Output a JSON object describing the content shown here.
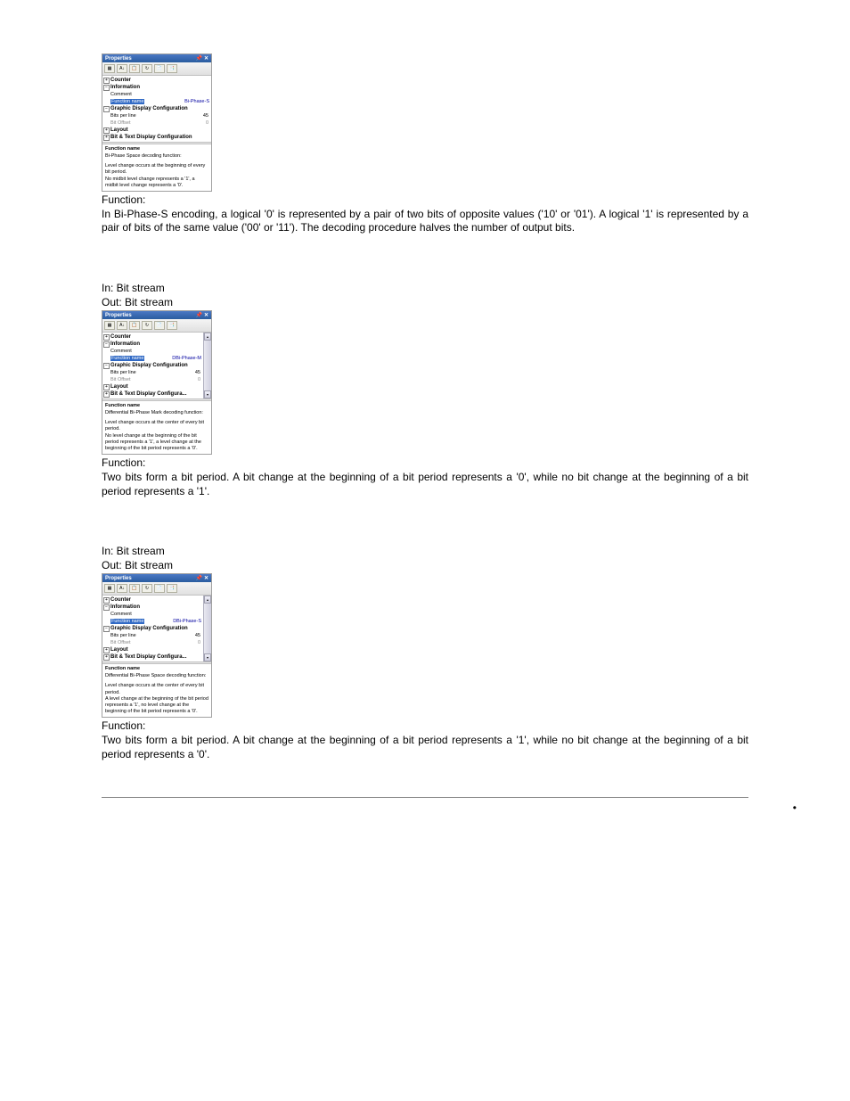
{
  "panel1": {
    "title": "Properties",
    "tree": {
      "counter": "Counter",
      "information": "Information",
      "comment": "Comment",
      "functionNameLabel": "Function name",
      "functionNameValue": "Bi-Phase-S",
      "gdc": "Graphic Display Configuration",
      "bitsPerLineLabel": "Bits per line",
      "bitsPerLineValue": "45",
      "bitOffsetLabel": "Bit Offset",
      "bitOffsetValue": "0",
      "layout": "Layout",
      "btdc": "Bit & Text Display Configuration"
    },
    "descTitle": "Function name",
    "descLine1": "Bi-Phase Space decoding function:",
    "descLine2": "Level change occurs at the beginning of every bit period.",
    "descLine3": "No midbit level change represents a '1', a midbit level change represents a '0'."
  },
  "section1": {
    "functionHeading": "Function:",
    "functionBody": "In Bi-Phase-S encoding, a logical '0' is represented by a pair of two bits of opposite values ('10' or '01'). A logical '1' is represented by a pair of bits of the same value ('00' or '11'). The decoding procedure halves the number of output bits.",
    "inLine": "In: Bit stream",
    "outLine": "Out: Bit stream"
  },
  "panel2": {
    "title": "Properties",
    "tree": {
      "counter": "Counter",
      "information": "Information",
      "comment": "Comment",
      "functionNameLabel": "Function name",
      "functionNameValue": "DBi-Phase-M",
      "gdc": "Graphic Display Configuration",
      "bitsPerLineLabel": "Bits per line",
      "bitsPerLineValue": "45",
      "bitOffsetLabel": "Bit Offset",
      "bitOffsetValue": "0",
      "layout": "Layout",
      "btdc": "Bit & Text Display Configura..."
    },
    "descTitle": "Function name",
    "descLine1": "Differential Bi-Phase Mark decoding function:",
    "descLine2": "Level change occurs at the center of every bit period.",
    "descLine3": "No level change at the beginning of the bit period represents a '1', a level change at the beginning of the bit period represents a '0'."
  },
  "section2": {
    "functionHeading": "Function:",
    "functionBody": "Two bits form a bit period. A bit change at the beginning of a bit period represents a '0', while no bit change at the beginning of a bit period represents a '1'.",
    "inLine": "In: Bit stream",
    "outLine": "Out: Bit stream"
  },
  "panel3": {
    "title": "Properties",
    "tree": {
      "counter": "Counter",
      "information": "Information",
      "comment": "Comment",
      "functionNameLabel": "Function name",
      "functionNameValue": "DBi-Phase-S",
      "gdc": "Graphic Display Configuration",
      "bitsPerLineLabel": "Bits per line",
      "bitsPerLineValue": "45",
      "bitOffsetLabel": "Bit Offset",
      "bitOffsetValue": "0",
      "layout": "Layout",
      "btdc": "Bit & Text Display Configura..."
    },
    "descTitle": "Function name",
    "descLine1": "Differential Bi-Phase Space decoding function:",
    "descLine2": "Level change occurs at the center of every bit period.",
    "descLine3": "A level change at the beginning of the bit period represents a '1', no level change at the beginning of the bit period represents a '0'."
  },
  "section3": {
    "functionHeading": "Function:",
    "functionBody": "Two bits form a bit period. A bit change at the beginning of a bit period represents a '1', while no bit change at the beginning of a bit period represents a '0'."
  },
  "toolbar": {
    "b1": "▦",
    "b2": "A↓",
    "b3": "📋",
    "b4": "↻",
    "b5": "📄",
    "b6": "📑"
  }
}
